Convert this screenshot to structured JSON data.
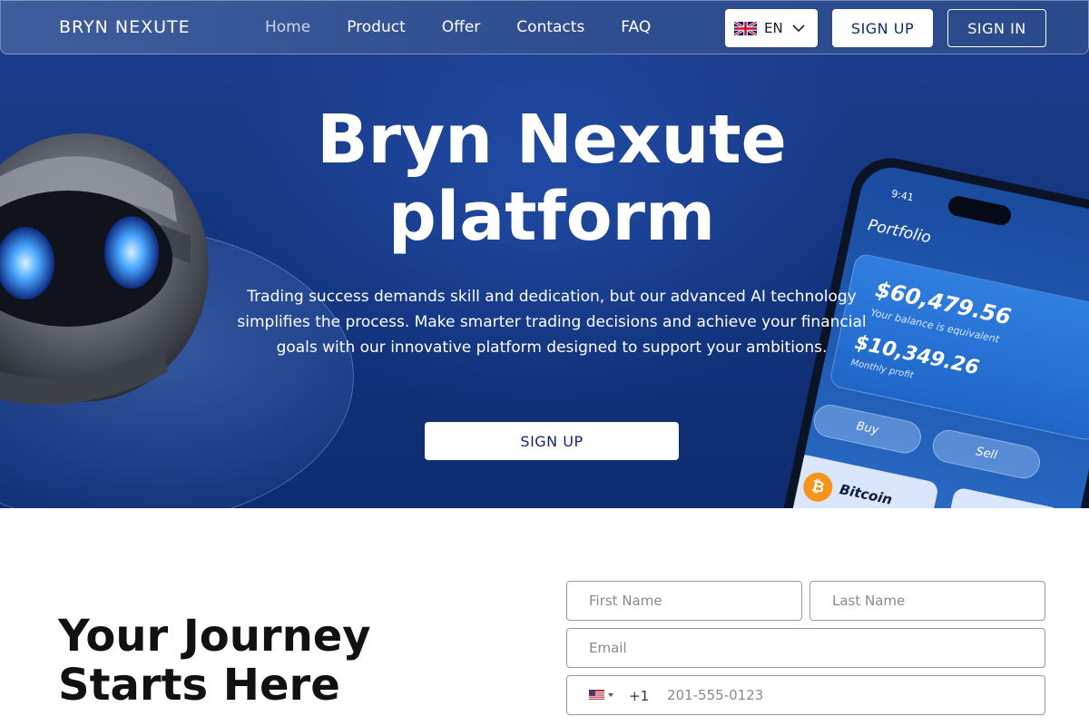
{
  "header": {
    "brand": "BRYN NEXUTE",
    "nav": [
      {
        "label": "Home",
        "active": true
      },
      {
        "label": "Product"
      },
      {
        "label": "Offer"
      },
      {
        "label": "Contacts"
      },
      {
        "label": "FAQ"
      }
    ],
    "language": {
      "code": "EN",
      "flag_icon": "uk-flag-icon"
    },
    "signup_label": "SIGN UP",
    "signin_label": "SIGN IN"
  },
  "hero": {
    "title_line1": "Bryn Nexute",
    "title_line2": "platform",
    "description": "Trading success demands skill and dedication, but our advanced AI technology simplifies the process. Make smarter trading decisions and achieve your financial goals with our innovative platform designed to support your ambitions.",
    "cta_label": "SIGN UP",
    "phone_mockup": {
      "time": "9:41",
      "title": "Portfolio",
      "balance": "$60,479.56",
      "balance_label": "Your balance is equivalent",
      "profit": "$10,349.26",
      "profit_label": "Monthly profit",
      "buy_label": "Buy",
      "sell_label": "Sell",
      "coin_name": "Bitcoin",
      "coin_symbol": "₿"
    }
  },
  "signup_section": {
    "heading": "Your Journey Starts Here",
    "first_name_placeholder": "First Name",
    "last_name_placeholder": "Last Name",
    "email_placeholder": "Email",
    "phone_country_code": "+1",
    "phone_placeholder": "201-555-0123",
    "phone_flag_icon": "us-flag-icon"
  },
  "colors": {
    "hero_bg": "#14357f",
    "button_text": "#0f2a66",
    "white": "#ffffff"
  }
}
